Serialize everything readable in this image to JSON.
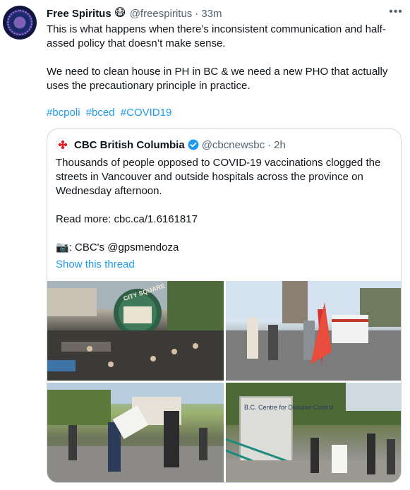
{
  "tweet": {
    "author_name": "Free Spiritus",
    "emoji": "😷",
    "handle": "@freespiritus",
    "separator": "·",
    "time": "33m",
    "more_icon": "more-horizontal-icon",
    "text": "This is what happens when there’s inconsistent communication and half-assed policy that doesn’t make sense.\n\nWe need to clean house in PH in BC & we need a new PHO that actually uses the precautionary principle in practice.",
    "hashtags": [
      "#bcpoli",
      "#bced",
      "#COVID19"
    ]
  },
  "quote": {
    "author_name": "CBC British Columbia",
    "handle": "@cbcnewsbc",
    "separator": "·",
    "time": "2h",
    "text": "Thousands of people opposed to COVID-19 vaccinations clogged the streets in Vancouver and outside hospitals across the province on Wednesday afternoon.\n\nRead more: cbc.ca/1.6161817\n\n📷: CBC's @gpsmendoza",
    "show_thread": "Show this thread",
    "photos": [
      {
        "name": "photo-city-square-crowd",
        "sign_text": "CITY SQUARE"
      },
      {
        "name": "photo-protest-flag"
      },
      {
        "name": "photo-marchers-sign"
      },
      {
        "name": "photo-disease-control-sign",
        "sign_text": "B.C. Centre for Disease Control"
      }
    ]
  },
  "colors": {
    "link": "#1d9bf0",
    "secondary_text": "#536471",
    "border": "#cfd9de",
    "verified": "#1d9bf0"
  }
}
